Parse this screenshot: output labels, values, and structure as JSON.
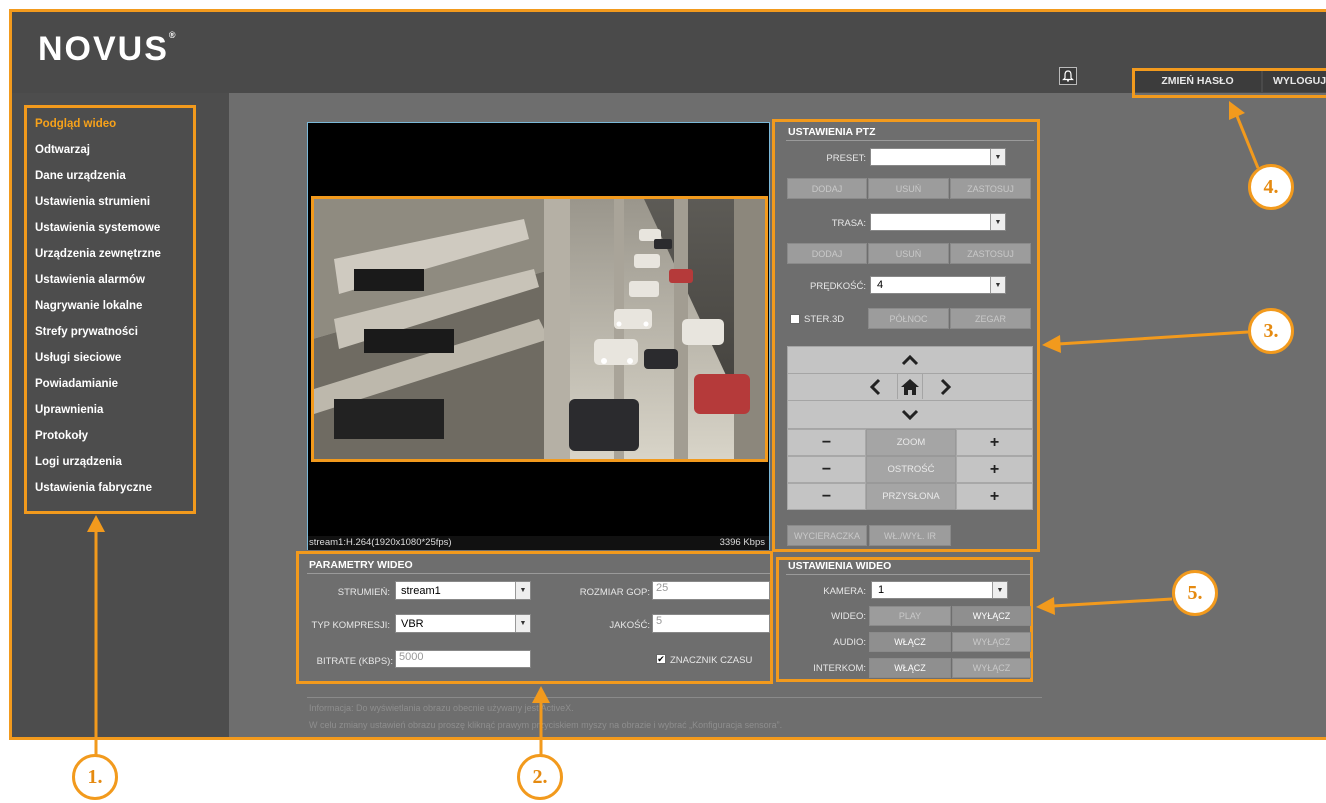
{
  "brand": {
    "logo": "NOVUS",
    "reg": "®"
  },
  "header": {
    "change_password": "ZMIEŃ HASŁO",
    "logout": "WYLOGUJ"
  },
  "sidebar": {
    "items": [
      {
        "label": "Podgląd wideo",
        "active": true
      },
      {
        "label": "Odtwarzaj"
      },
      {
        "label": "Dane urządzenia"
      },
      {
        "label": "Ustawienia strumieni"
      },
      {
        "label": "Ustawienia systemowe"
      },
      {
        "label": "Urządzenia zewnętrzne"
      },
      {
        "label": "Ustawienia alarmów"
      },
      {
        "label": "Nagrywanie lokalne"
      },
      {
        "label": "Strefy prywatności"
      },
      {
        "label": "Usługi sieciowe"
      },
      {
        "label": "Powiadamianie"
      },
      {
        "label": "Uprawnienia"
      },
      {
        "label": "Protokoły"
      },
      {
        "label": "Logi urządzenia"
      },
      {
        "label": "Ustawienia fabryczne"
      }
    ]
  },
  "video": {
    "stream_info": "stream1:H.264(1920x1080*25fps)",
    "bitrate": "3396 Kbps"
  },
  "video_params": {
    "title": "PARAMETRY WIDEO",
    "stream_label": "STRUMIEŃ:",
    "stream_value": "stream1",
    "gop_label": "ROZMIAR GOP:",
    "gop_value": "25",
    "compression_label": "TYP KOMPRESJI:",
    "compression_value": "VBR",
    "quality_label": "JAKOŚĆ:",
    "quality_value": "5",
    "bitrate_label": "BITRATE (KBPS):",
    "bitrate_value": "5000",
    "timestamp_label": "ZNACZNIK CZASU",
    "timestamp_checked": true
  },
  "ptz": {
    "title": "USTAWIENIA PTZ",
    "preset_label": "PRESET:",
    "route_label": "TRASA:",
    "add": "DODAJ",
    "delete": "USUŃ",
    "apply": "ZASTOSUJ",
    "speed_label": "PRĘDKOŚĆ:",
    "speed_value": "4",
    "ster3d": "STER.3D",
    "north": "PÓŁNOC",
    "clock": "ZEGAR",
    "zoom": "ZOOM",
    "focus": "OSTROŚĆ",
    "iris": "PRZYSŁONA",
    "minus": "−",
    "plus": "+",
    "wiper": "WYCIERACZKA",
    "ir": "WŁ./WYŁ. IR"
  },
  "video_settings": {
    "title": "USTAWIENIA WIDEO",
    "camera_label": "KAMERA:",
    "camera_value": "1",
    "video_label": "WIDEO:",
    "audio_label": "AUDIO:",
    "intercom_label": "INTERKOM:",
    "play": "PLAY",
    "off": "WYŁĄCZ",
    "on": "WŁĄCZ"
  },
  "info": {
    "line1": "Informacja: Do wyświetlania obrazu obecnie używany jest ActiveX.",
    "line2": "W celu zmiany ustawień obrazu proszę kliknąć prawym przyciskiem myszy na obrazie i wybrać „Konfiguracja sensora”."
  },
  "callouts": [
    "1.",
    "2.",
    "3.",
    "4.",
    "5."
  ],
  "colors": {
    "accent": "#f29a1d",
    "active_menu": "#f7a21a"
  }
}
